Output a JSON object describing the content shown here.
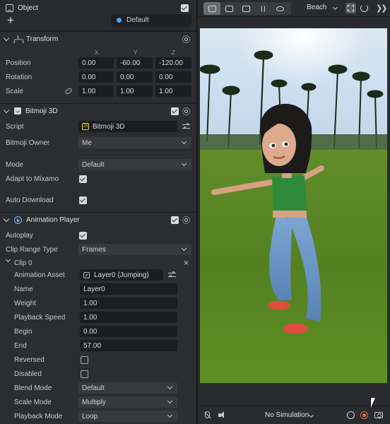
{
  "object_header": {
    "title": "Object",
    "enabled": true,
    "add_label": "+",
    "layer": "Default"
  },
  "transform": {
    "title": "Transform",
    "axes": [
      "X",
      "Y",
      "Z"
    ],
    "position_label": "Position",
    "position": [
      "0.00",
      "-60.00",
      "-120.00"
    ],
    "rotation_label": "Rotation",
    "rotation": [
      "0.00",
      "0.00",
      "0.00"
    ],
    "scale_label": "Scale",
    "scale": [
      "1.00",
      "1.00",
      "1.00"
    ]
  },
  "bitmoji": {
    "title": "Bitmoji 3D",
    "enabled": true,
    "script_label": "Script",
    "script_value": "Bitmoji 3D",
    "script_badge": "JS",
    "owner_label": "Bitmoji Owner",
    "owner_value": "Me",
    "mode_label": "Mode",
    "mode_value": "Default",
    "mixamo_label": "Adapt to Mixamo",
    "mixamo": true,
    "autodownload_label": "Auto Download",
    "autodownload": true
  },
  "animation_player": {
    "title": "Animation Player",
    "enabled": true,
    "autoplay_label": "Autoplay",
    "autoplay": true,
    "clip_range_label": "Clip Range Type",
    "clip_range_value": "Frames",
    "clip": {
      "title": "Clip 0",
      "close_label": "×",
      "asset_label": "Animation Asset",
      "asset_value": "Layer0 (Jumping)",
      "name_label": "Name",
      "name_value": "Layer0",
      "weight_label": "Weight",
      "weight_value": "1.00",
      "speed_label": "Playback Speed",
      "speed_value": "1.00",
      "begin_label": "Begin",
      "begin_value": "0.00",
      "end_label": "End",
      "end_value": "57.00",
      "reversed_label": "Reversed",
      "reversed": false,
      "disabled_label": "Disabled",
      "disabled": false,
      "blend_label": "Blend Mode",
      "blend_value": "Default",
      "scale_mode_label": "Scale Mode",
      "scale_mode_value": "Multiply",
      "playback_mode_label": "Playback Mode",
      "playback_mode_value": "Loop"
    }
  },
  "scene": {
    "toolbar": {
      "tools": [
        "scene-view-icon",
        "camera-icon",
        "preview-icon",
        "pause-icon",
        "visibility-icon"
      ],
      "active_tool": 0,
      "environment": "Beach"
    },
    "bottom": {
      "simulation": "No Simulation"
    }
  },
  "colors": {
    "panel_bg": "#2a2b2e",
    "field_bg": "#1c1d20",
    "accent_blue": "#3ea8ff",
    "script_yellow": "#e4d340",
    "record_orange": "#e86a3a"
  }
}
